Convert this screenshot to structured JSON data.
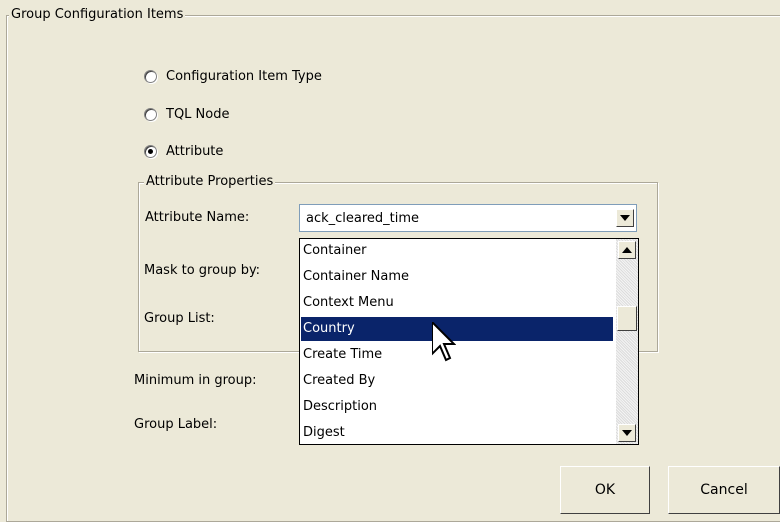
{
  "group": {
    "title": "Group Configuration Items",
    "options": [
      {
        "label": "Configuration Item Type",
        "selected": false
      },
      {
        "label": "TQL Node",
        "selected": false
      },
      {
        "label": "Attribute",
        "selected": true
      }
    ]
  },
  "attribute_properties": {
    "title": "Attribute Properties",
    "attribute_name_label": "Attribute Name:",
    "attribute_name_value": "ack_cleared_time",
    "mask_label": "Mask to group by:",
    "group_list_label": "Group List:"
  },
  "minimum_label": "Minimum in group:",
  "group_label_label": "Group Label:",
  "dropdown": {
    "items": [
      "Container",
      "Container Name",
      "Context Menu",
      "Country",
      "Create Time",
      "Created By",
      "Description",
      "Digest"
    ],
    "selected_index": 3
  },
  "buttons": {
    "ok": "OK",
    "cancel": "Cancel"
  },
  "colors": {
    "selection": "#0a246a",
    "background": "#ece9d8"
  }
}
